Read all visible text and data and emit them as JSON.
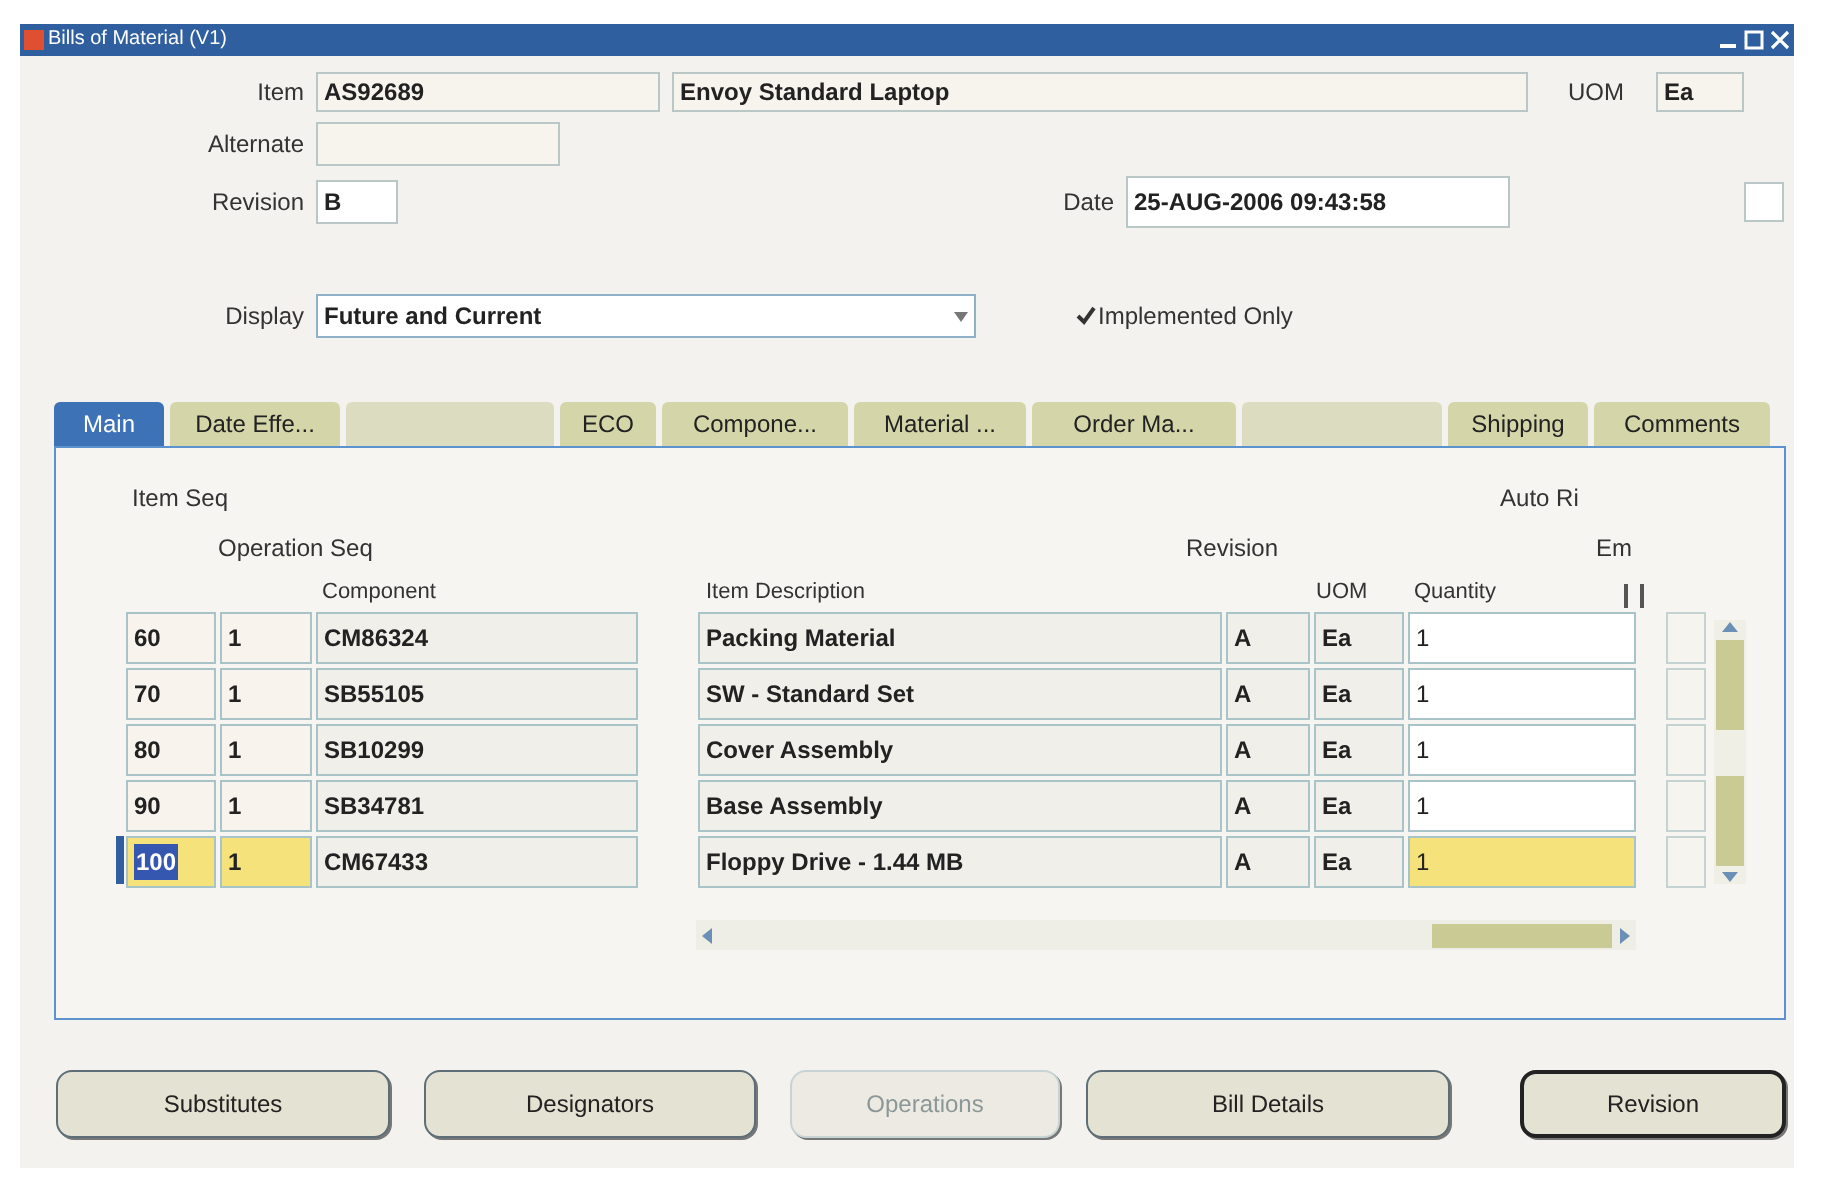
{
  "window": {
    "title": "Bills of Material (V1)"
  },
  "header": {
    "item": {
      "label": "Item",
      "value": "AS92689"
    },
    "item_description": "Envoy Standard Laptop",
    "uom": {
      "label": "UOM",
      "value": "Ea"
    },
    "alternate": {
      "label": "Alternate"
    },
    "revision": {
      "label": "Revision",
      "value": "B"
    },
    "date": {
      "label": "Date",
      "value": "25-AUG-2006 09:43:58"
    },
    "display": {
      "label": "Display",
      "value": "Future and Current"
    },
    "implemented_only": {
      "label": "Implemented Only",
      "checked": true
    }
  },
  "tabs": [
    {
      "label": "Main",
      "selected": true,
      "disabled": false
    },
    {
      "label": "Date Effe...",
      "selected": false,
      "disabled": false
    },
    {
      "selected": false,
      "disabled": true
    },
    {
      "label": "ECO",
      "selected": false,
      "disabled": false
    },
    {
      "label": "Compone...",
      "selected": false,
      "disabled": false
    },
    {
      "label": "Material ...",
      "selected": false,
      "disabled": false
    },
    {
      "label": "Order Ma...",
      "selected": false,
      "disabled": false
    },
    {
      "selected": false,
      "disabled": true
    },
    {
      "label": "Shipping",
      "selected": false,
      "disabled": false
    },
    {
      "label": "Comments",
      "selected": false,
      "disabled": false
    }
  ],
  "table": {
    "headers": {
      "item_seq": "Item Seq",
      "auto_request": "Auto Ri",
      "operation_seq": "Operation Seq",
      "revision": "Revision",
      "column_em": "Em",
      "component": "Component",
      "description": "Item Description",
      "uom": "UOM",
      "quantity": "Quantity"
    },
    "rows": [
      {
        "item_seq": "60",
        "operation_seq": "1",
        "component": "CM86324",
        "description": "Packing Material",
        "revision": "A",
        "uom": "Ea",
        "quantity": "1",
        "selected": false
      },
      {
        "item_seq": "70",
        "operation_seq": "1",
        "component": "SB55105",
        "description": "SW - Standard Set",
        "revision": "A",
        "uom": "Ea",
        "quantity": "1",
        "selected": false
      },
      {
        "item_seq": "80",
        "operation_seq": "1",
        "component": "SB10299",
        "description": "Cover Assembly",
        "revision": "A",
        "uom": "Ea",
        "quantity": "1",
        "selected": false
      },
      {
        "item_seq": "90",
        "operation_seq": "1",
        "component": "SB34781",
        "description": "Base Assembly",
        "revision": "A",
        "uom": "Ea",
        "quantity": "1",
        "selected": false
      },
      {
        "item_seq": "100",
        "operation_seq": "1",
        "component": "CM67433",
        "description": "Floppy Drive - 1.44 MB",
        "revision": "A",
        "uom": "Ea",
        "quantity": "1",
        "selected": true
      }
    ]
  },
  "buttons": [
    {
      "label": "Substitutes",
      "disabled": false
    },
    {
      "label": "Designators",
      "disabled": false
    },
    {
      "label": "Operations",
      "disabled": true
    },
    {
      "label": "Bill Details",
      "disabled": false
    },
    {
      "label": "Revision",
      "disabled": false
    }
  ]
}
